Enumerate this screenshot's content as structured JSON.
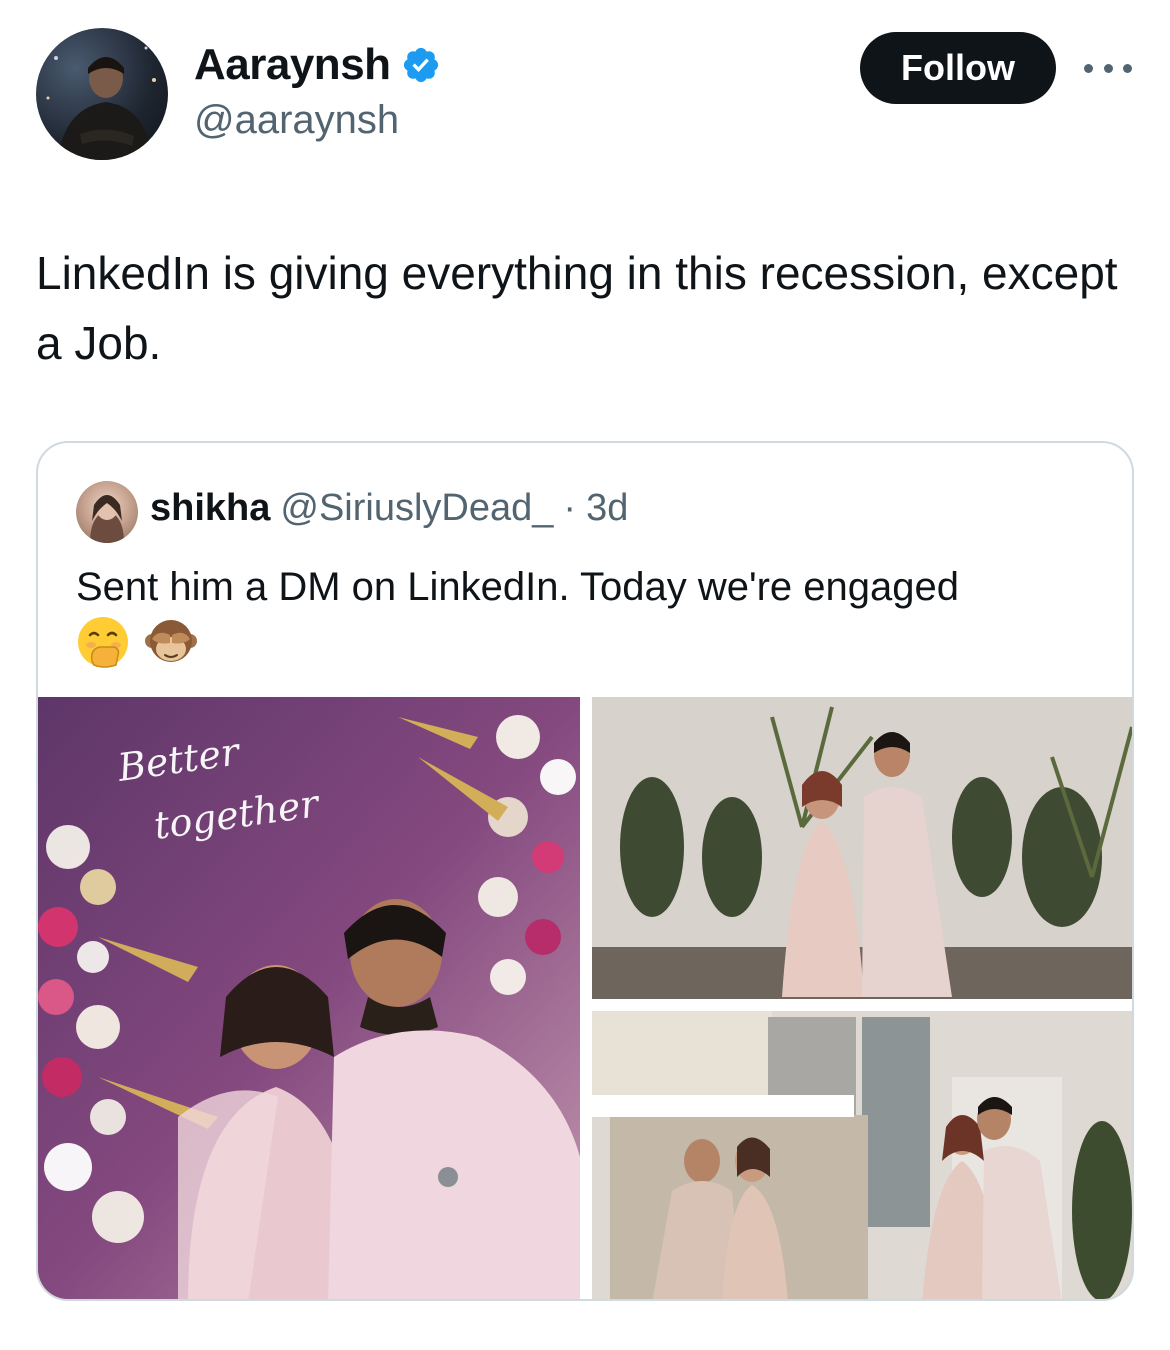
{
  "author": {
    "display_name": "Aaraynsh",
    "handle": "@aaraynsh",
    "verified": true,
    "avatar_icon": "user-avatar"
  },
  "actions": {
    "follow_label": "Follow",
    "more_icon": "more-horizontal-icon"
  },
  "tweet": {
    "text": "LinkedIn is giving everything in this recession, except a Job."
  },
  "quoted_tweet": {
    "display_name": "shikha",
    "handle": "@SiriuslyDead_",
    "separator": "·",
    "time": "3d",
    "text": "Sent him a DM on LinkedIn. Today we're engaged",
    "emojis": [
      "🤭",
      "🙈"
    ],
    "neon_sign_text": "Better together"
  },
  "colors": {
    "text_primary": "#0f1419",
    "text_secondary": "#536471",
    "follow_bg": "#0f1419",
    "verified_blue": "#1d9bf0",
    "card_border": "#cfd9de"
  }
}
